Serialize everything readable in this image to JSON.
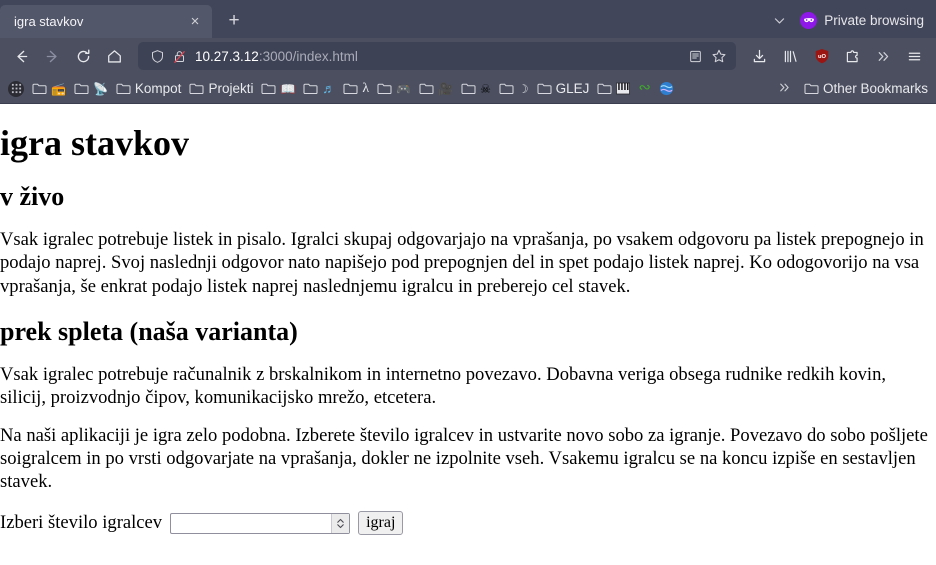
{
  "browser": {
    "tab": {
      "title": "igra stavkov",
      "close_label": "×"
    },
    "new_tab_label": "+",
    "all_tabs_label": "⌄",
    "private_browsing": {
      "label": "Private browsing",
      "badge_color": "#8d18e8"
    },
    "nav": {
      "back_label": "←",
      "forward_label": "→",
      "reload_label": "↻",
      "home_label": "⌂"
    },
    "url": {
      "host": "10.27.3.12",
      "path": ":3000/index.html",
      "shield_icon": "shield-icon",
      "lock_icon": "lock-crossed-icon",
      "reader_icon": "reader-view-icon",
      "bookmark_star_icon": "star-icon"
    },
    "toolbar_right": {
      "downloads_label": "downloads-icon",
      "library_label": "library-icon",
      "ublock_label": "uO",
      "extensions_label": "extensions-icon",
      "overflow_label": "»",
      "menu_label": "☰"
    },
    "bookmarks": {
      "items": [
        {
          "label": "",
          "icon": "waffle-circle-icon"
        },
        {
          "label": "",
          "icon": "folder-icon"
        },
        {
          "label": "",
          "icon": "radio-icon"
        },
        {
          "label": "",
          "icon": "folder-icon"
        },
        {
          "label": "",
          "icon": "satellite-icon"
        },
        {
          "label": "Kompot",
          "icon": "folder-icon"
        },
        {
          "label": "Projekti",
          "icon": "folder-icon"
        },
        {
          "label": "",
          "icon": "folder-icon"
        },
        {
          "label": "",
          "icon": "book-icon"
        },
        {
          "label": "",
          "icon": "folder-icon"
        },
        {
          "label": "",
          "icon": "music-icon"
        },
        {
          "label": "",
          "icon": "folder-icon"
        },
        {
          "label": "",
          "icon": "lambda-icon"
        },
        {
          "label": "",
          "icon": "folder-icon"
        },
        {
          "label": "",
          "icon": "gamepad-icon"
        },
        {
          "label": "",
          "icon": "folder-icon"
        },
        {
          "label": "",
          "icon": "movie-camera-icon"
        },
        {
          "label": "",
          "icon": "folder-icon"
        },
        {
          "label": "",
          "icon": "skull-icon"
        },
        {
          "label": "",
          "icon": "folder-icon"
        },
        {
          "label": "",
          "icon": "moon-icon"
        },
        {
          "label": "GLEJ",
          "icon": "folder-icon"
        },
        {
          "label": "",
          "icon": "folder-icon"
        },
        {
          "label": "",
          "icon": "piano-icon"
        },
        {
          "label": "",
          "icon": "squiggle-icon"
        },
        {
          "label": "",
          "icon": "globe-icon"
        }
      ],
      "overflow_label": "»",
      "other_bookmarks_label": "Other Bookmarks"
    }
  },
  "page": {
    "h1": "igra stavkov",
    "h2_live": "v živo",
    "p_live": "Vsak igralec potrebuje listek in pisalo. Igralci skupaj odgovarjajo na vprašanja, po vsakem odgovoru pa listek prepognejo in podajo naprej. Svoj naslednji odgovor nato napišejo pod prepognjen del in spet podajo listek naprej. Ko odogovorijo na vsa vprašanja, še enkrat podajo listek naprej naslednjemu igralcu in preberejo cel stavek.",
    "h2_web": "prek spleta (naša varianta)",
    "p_web_1": "Vsak igralec potrebuje računalnik z brskalnikom in internetno povezavo. Dobavna veriga obsega rudnike redkih kovin, silicij, proizvodnjo čipov, komunikacijsko mrežo, etcetera.",
    "p_web_2": "Na naši aplikaciji je igra zelo podobna. Izberete število igralcev in ustvarite novo sobo za igranje. Povezavo do sobo pošljete soigralcem in po vrsti odgovarjate na vprašanja, dokler ne izpolnite vseh. Vsakemu igralcu se na koncu izpiše en sestavljen stavek.",
    "form": {
      "label": "Izberi število igralcev",
      "select_value": "",
      "select_placeholder": "",
      "button_label": "igraj"
    }
  }
}
